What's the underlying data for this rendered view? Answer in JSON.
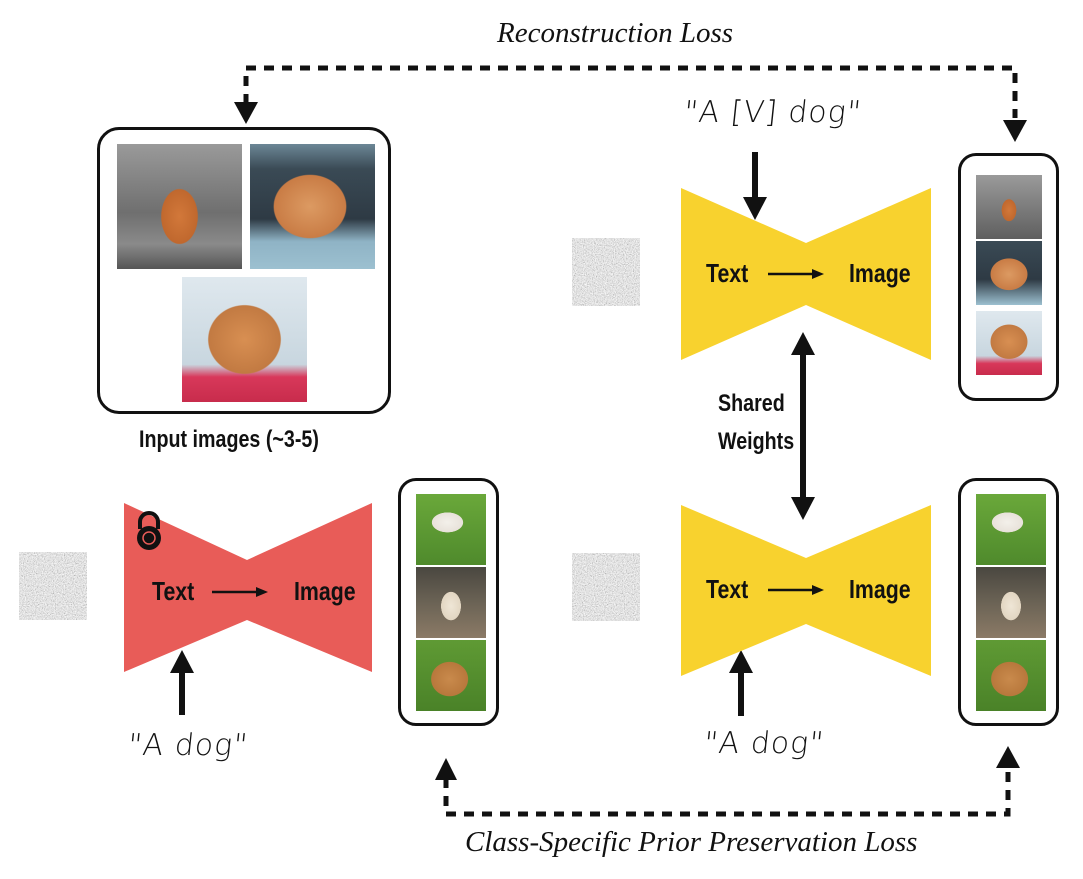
{
  "title_top": "Reconstruction Loss",
  "title_bottom": "Class-Specific Prior Preservation Loss",
  "input_images": {
    "caption": "Input images (~3-5)",
    "images": [
      {
        "description": "chow chow walking on foggy path"
      },
      {
        "description": "chow chow leaning out of car window"
      },
      {
        "description": "chow chow lying on red cloth"
      }
    ]
  },
  "prompts": {
    "subject": "\"A [V] dog\"",
    "class_left": "\"A dog\"",
    "class_right": "\"A dog\""
  },
  "models": {
    "frozen": {
      "text_label": "Text",
      "image_label": "Image",
      "color": "#E85C58",
      "locked": true
    },
    "finetune_top": {
      "text_label": "Text",
      "image_label": "Image",
      "color": "#F8D22E"
    },
    "finetune_bottom": {
      "text_label": "Text",
      "image_label": "Image",
      "color": "#F8D22E"
    }
  },
  "shared_weights": {
    "line1": "Shared",
    "line2": "Weights"
  },
  "outputs": {
    "subject_strip": [
      "chow chow walking",
      "chow chow in car",
      "chow chow on red cloth"
    ],
    "prior_strip_left": [
      "white-brown dog on grass",
      "white lab sitting",
      "tan dog tongue out"
    ],
    "prior_strip_right": [
      "white-brown dog on grass",
      "white lab sitting",
      "tan dog tongue out"
    ]
  },
  "icons": {
    "lock": "lock-icon",
    "noise": "noise-image"
  }
}
